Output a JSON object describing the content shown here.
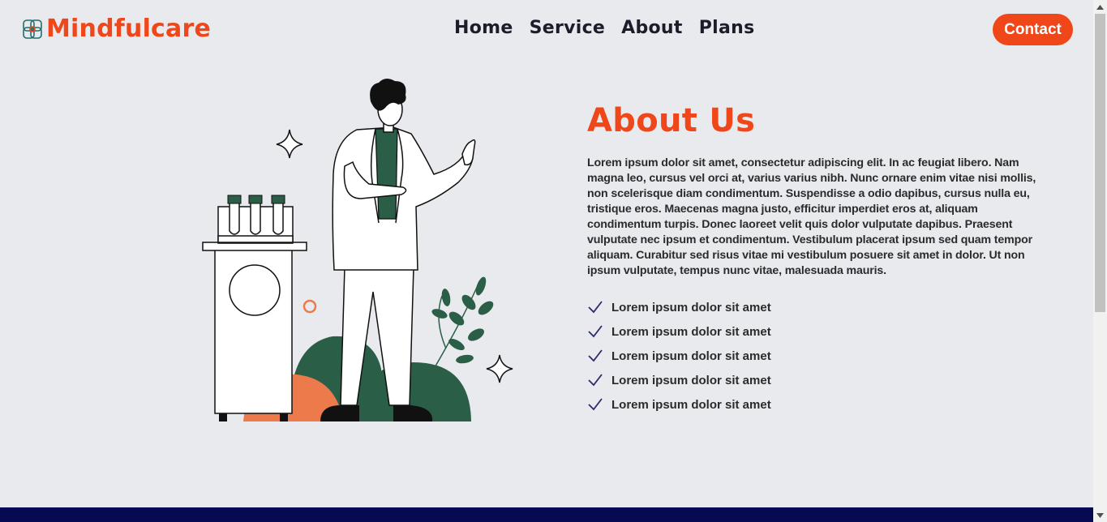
{
  "brand": {
    "name": "Mindfulcare",
    "icon": "flower-logo-icon"
  },
  "nav": {
    "items": [
      {
        "label": "Home"
      },
      {
        "label": "Service"
      },
      {
        "label": "About"
      },
      {
        "label": "Plans"
      }
    ]
  },
  "header": {
    "contact_label": "Contact"
  },
  "about": {
    "title": "About Us",
    "body": "Lorem ipsum dolor sit amet, consectetur adipiscing elit. In ac feugiat libero. Nam magna leo, cursus vel orci at, varius varius nibh. Nunc ornare enim vitae nisi mollis, non scelerisque diam condimentum. Suspendisse a odio dapibus, cursus nulla eu, tristique eros. Maecenas magna justo, efficitur imperdiet eros at, aliquam condimentum turpis. Donec laoreet velit quis dolor vulputate dapibus. Praesent vulputate nec ipsum et condimentum. Vestibulum placerat ipsum sed quam tempor aliquam. Curabitur sed risus vitae mi vestibulum posuere sit amet in dolor. Ut non ipsum vulputate, tempus nunc vitae, malesuada mauris.",
    "features": [
      {
        "label": "Lorem ipsum dolor sit amet",
        "icon": "check-icon"
      },
      {
        "label": "Lorem ipsum dolor sit amet",
        "icon": "check-icon"
      },
      {
        "label": "Lorem ipsum dolor sit amet",
        "icon": "check-icon"
      },
      {
        "label": "Lorem ipsum dolor sit amet",
        "icon": "check-icon"
      },
      {
        "label": "Lorem ipsum dolor sit amet",
        "icon": "check-icon"
      }
    ]
  },
  "colors": {
    "accent": "#f0471a",
    "background": "#e8eaee",
    "footer": "#060a52",
    "illustration_green": "#2a5e46",
    "illustration_orange": "#ec7a4b"
  }
}
